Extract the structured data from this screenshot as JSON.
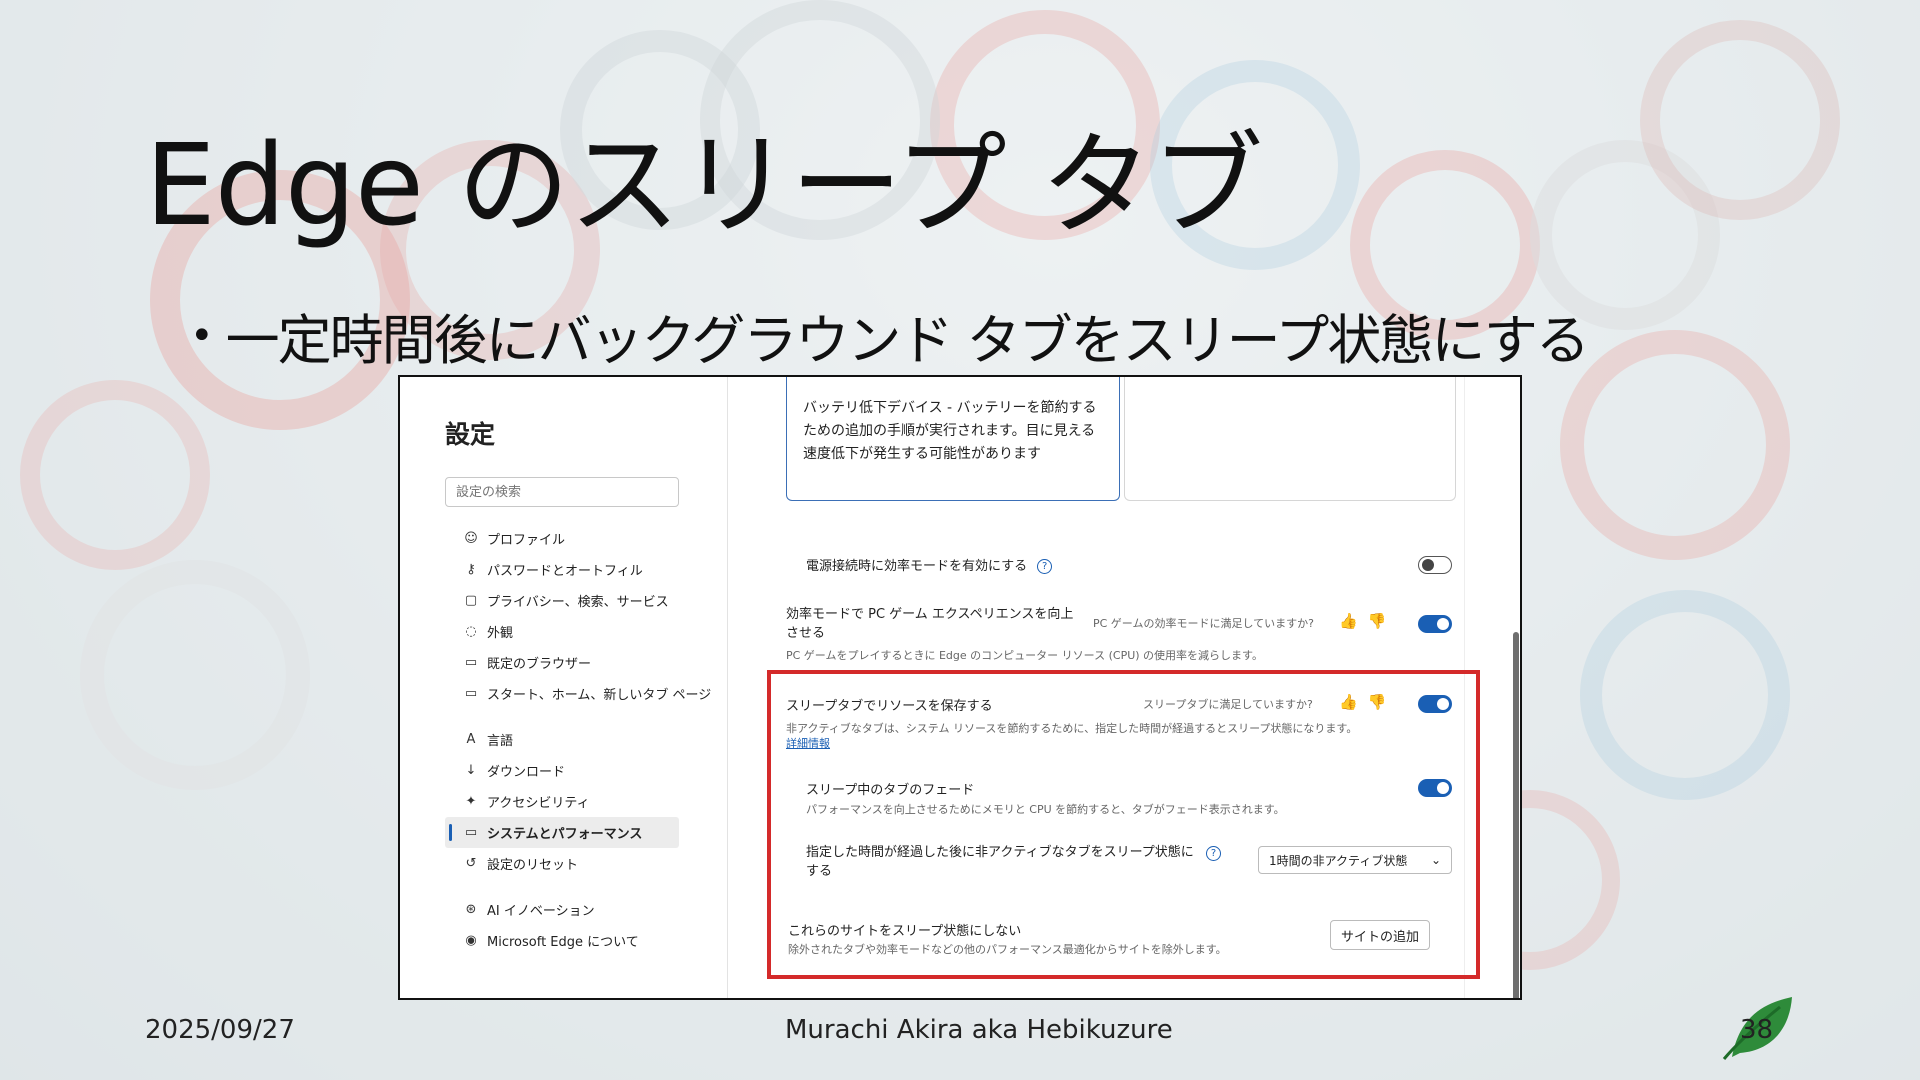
{
  "slide": {
    "title": "Edge のスリープ タブ",
    "bullet": "一定時間後にバックグラウンド タブをスリープ状態にする",
    "footer_date": "2025/09/27",
    "footer_author": "Murachi Akira aka Hebikuzure",
    "page_number": "38"
  },
  "settings": {
    "title": "設定",
    "search_placeholder": "設定の検索",
    "nav": [
      {
        "label": "プロファイル",
        "icon": "profile-icon"
      },
      {
        "label": "パスワードとオートフィル",
        "icon": "key-icon"
      },
      {
        "label": "プライバシー、検索、サービス",
        "icon": "lock-icon"
      },
      {
        "label": "外観",
        "icon": "palette-icon"
      },
      {
        "label": "既定のブラウザー",
        "icon": "browser-icon"
      },
      {
        "label": "スタート、ホーム、新しいタブ ページ",
        "icon": "home-icon"
      },
      {
        "label": "言語",
        "icon": "language-icon"
      },
      {
        "label": "ダウンロード",
        "icon": "download-icon"
      },
      {
        "label": "アクセシビリティ",
        "icon": "accessibility-icon"
      },
      {
        "label": "システムとパフォーマンス",
        "icon": "computer-icon"
      },
      {
        "label": "設定のリセット",
        "icon": "reset-icon"
      },
      {
        "label": "AI イノベーション",
        "icon": "ai-icon"
      },
      {
        "label": "Microsoft Edge について",
        "icon": "edge-icon"
      }
    ],
    "active_nav": "システムとパフォーマンス",
    "tooltip_text": "バッテリ低下デバイス - バッテリーを節約するための追加の手順が実行されます。目に見える速度低下が発生する可能性があります",
    "efficiency_on_power": {
      "label": "電源接続時に効率モードを有効にする",
      "enabled": false
    },
    "pc_gaming": {
      "label": "効率モードで PC ゲーム エクスペリエンスを向上させる",
      "feedback": "PC ゲームの効率モードに満足していますか?",
      "description": "PC ゲームをプレイするときに Edge のコンピューター リソース (CPU) の使用率を減らします。",
      "enabled": true
    },
    "sleeping_tabs": {
      "label": "スリープタブでリソースを保存する",
      "feedback": "スリープタブに満足していますか?",
      "description": "非アクティブなタブは、システム リソースを節約するために、指定した時間が経過するとスリープ状態になります。",
      "link": "詳細情報",
      "enabled": true
    },
    "fade_tabs": {
      "label": "スリープ中のタブのフェード",
      "description": "パフォーマンスを向上させるためにメモリと CPU を節約すると、タブがフェード表示されます。",
      "enabled": true
    },
    "sleep_after": {
      "label": "指定した時間が経過した後に非アクティブなタブをスリープ状態にする",
      "selected": "1時間の非アクティブ状態"
    },
    "never_sleep": {
      "label": "これらのサイトをスリープ状態にしない",
      "description": "除外されたタブや効率モードなどの他のパフォーマンス最適化からサイトを除外します。",
      "button": "サイトの追加"
    }
  }
}
